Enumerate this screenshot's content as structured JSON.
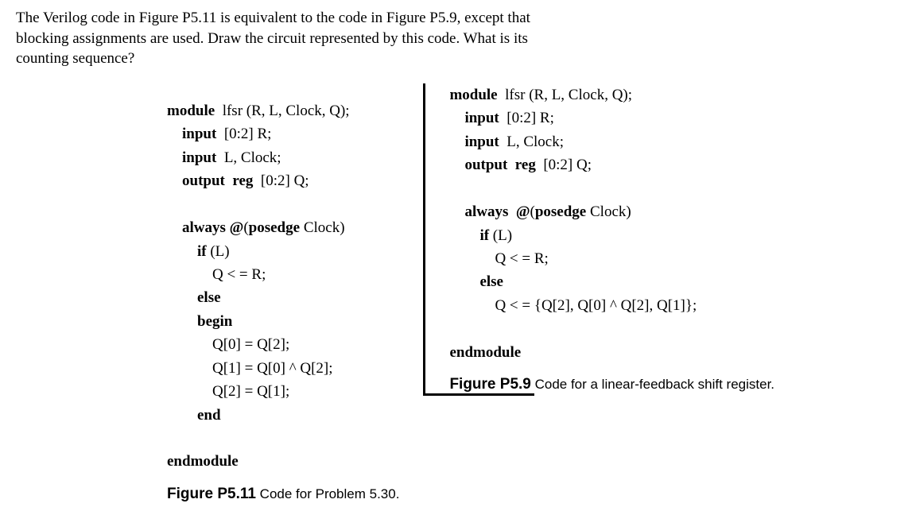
{
  "question": {
    "line1": "The Verilog code in Figure P5.11 is equivalent to the code in Figure P5.9, except that",
    "line2": "blocking assignments are used.  Draw the circuit represented by this code.  What is its",
    "line3": "counting sequence?"
  },
  "left": {
    "l1a": "module",
    "l1b": "  lfsr (R, L, Clock, Q);",
    "l2a": "    input",
    "l2b": "  [0:2] R;",
    "l3a": "    input",
    "l3b": "  L, Clock;",
    "l4a": "    output  reg",
    "l4b": "  [0:2] Q;",
    "l5": " ",
    "l6a": "    always @",
    "l6b": "(",
    "l6c": "posedge",
    "l6d": " Clock)",
    "l7a": "        if",
    "l7b": " (L)",
    "l8": "            Q < = R;",
    "l9a": "        else",
    "l10a": "        begin",
    "l11": "            Q[0] = Q[2];",
    "l12": "            Q[1] = Q[0] ^ Q[2];",
    "l13": "            Q[2] = Q[1];",
    "l14a": "        end",
    "l15": " ",
    "l16a": "endmodule",
    "caption_label": "Figure P5.11",
    "caption_text": "     Code for Problem 5.30."
  },
  "right": {
    "l1a": "module",
    "l1b": "  lfsr (R, L, Clock, Q);",
    "l2a": "    input",
    "l2b": "  [0:2] R;",
    "l3a": "    input",
    "l3b": "  L, Clock;",
    "l4a": "    output  reg",
    "l4b": "  [0:2] Q;",
    "l5": " ",
    "l6a": "    always  @",
    "l6b": "(",
    "l6c": "posedge",
    "l6d": " Clock)",
    "l7a": "        if",
    "l7b": " (L)",
    "l8": "            Q < = R;",
    "l9a": "        else",
    "l10": "            Q < = {Q[2], Q[0] ^ Q[2], Q[1]};",
    "l11": " ",
    "l12a": "endmodule",
    "caption_label": "Figure P5.9",
    "caption_text": "       Code for a linear-feedback shift register."
  }
}
